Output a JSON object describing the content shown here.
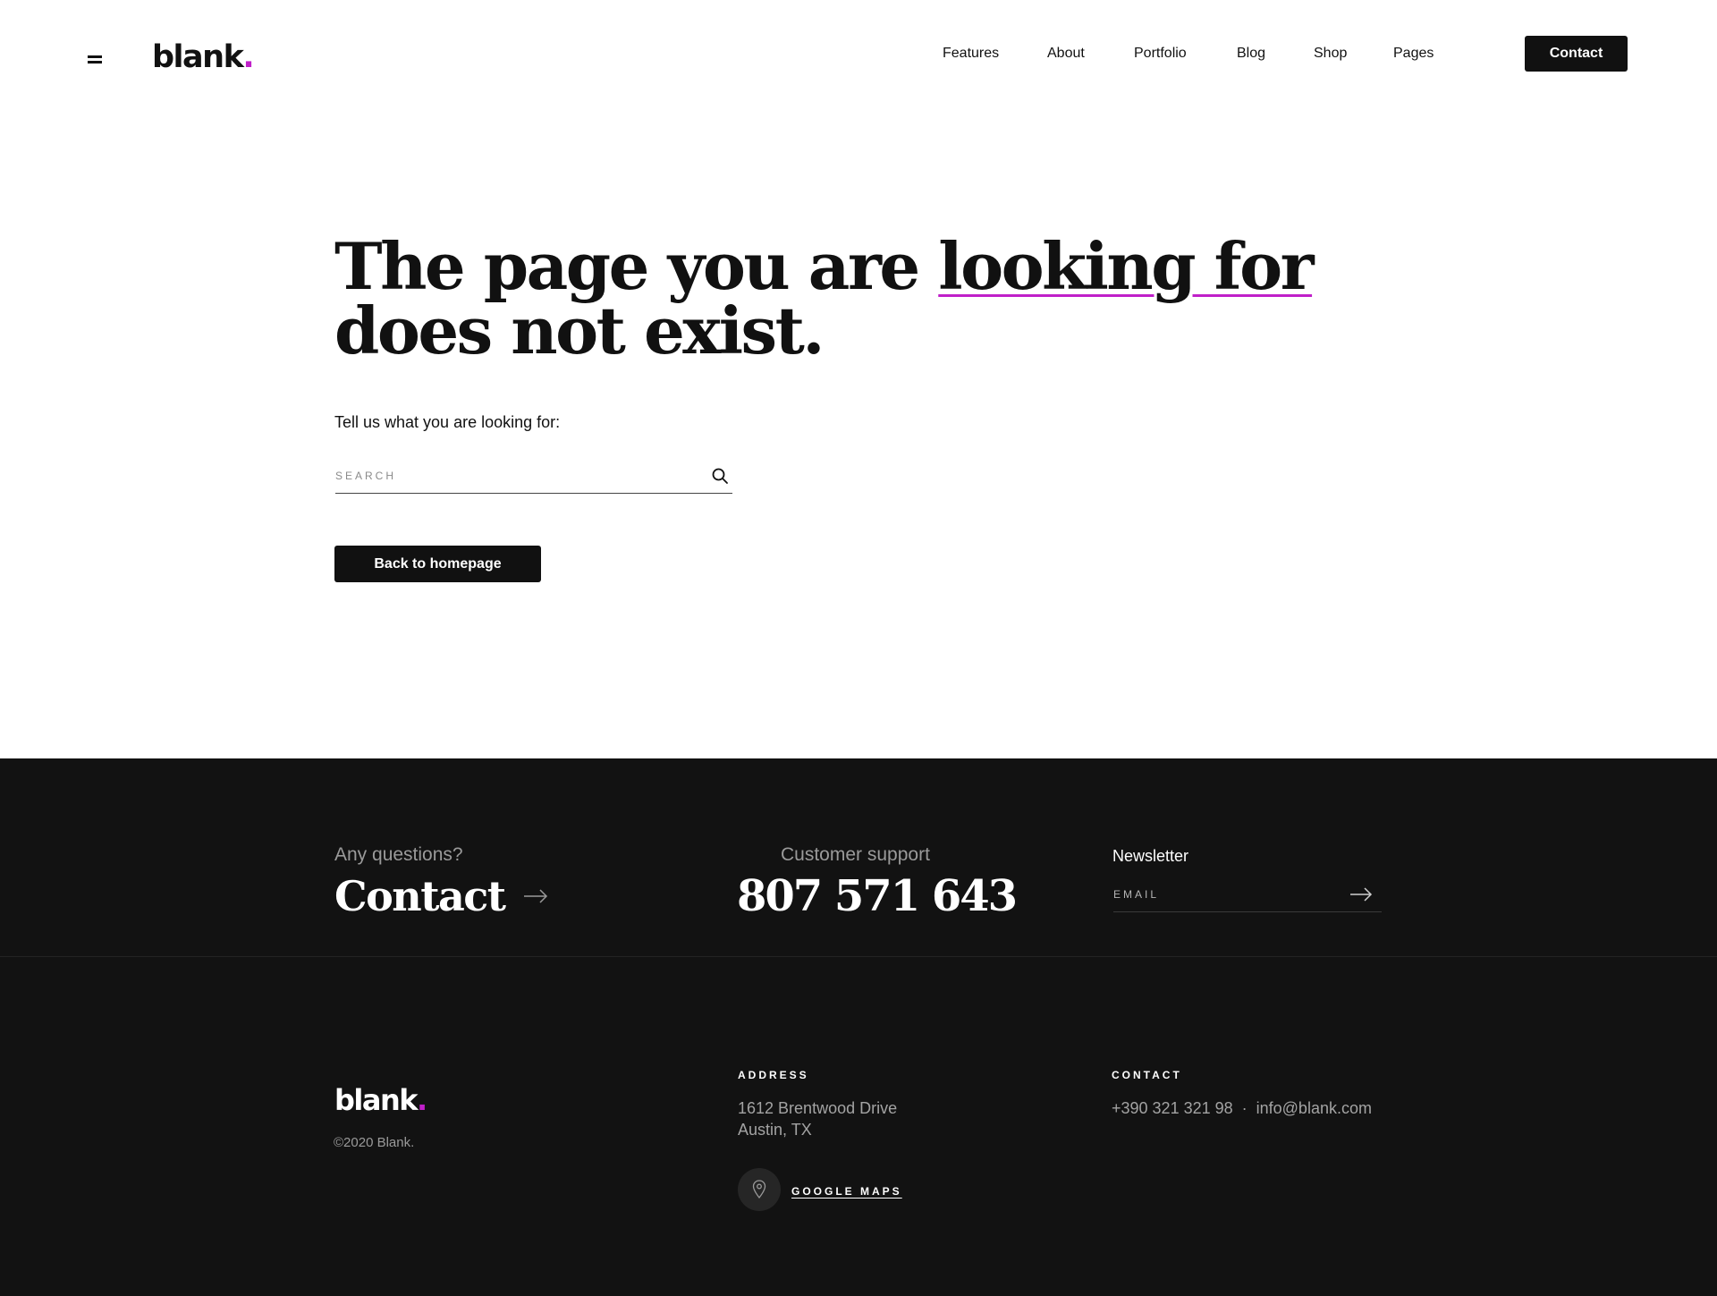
{
  "header": {
    "logo_text": "blank",
    "logo_dot": ".",
    "nav": [
      {
        "label": "Features"
      },
      {
        "label": "About"
      },
      {
        "label": "Portfolio"
      },
      {
        "label": "Blog"
      },
      {
        "label": "Shop"
      },
      {
        "label": "Pages"
      }
    ],
    "contact_button": "Contact"
  },
  "main": {
    "headline_part1": "The page you are ",
    "headline_highlight": "looking for",
    "headline_part2": "does not exist.",
    "prompt": "Tell us what you are looking for:",
    "search_placeholder": "SEARCH",
    "back_button": "Back to homepage"
  },
  "footer": {
    "questions_label": "Any questions?",
    "contact_link": "Contact",
    "support_label": "Customer support",
    "phone": "807 571 643",
    "newsletter_title": "Newsletter",
    "email_placeholder": "EMAIL",
    "logo_text": "blank",
    "logo_dot": ".",
    "copyright": "©2020 Blank.",
    "address_heading": "ADDRESS",
    "address_line1": "1612  Brentwood Drive",
    "address_line2": "Austin, TX",
    "maps_link": "GOOGLE MAPS",
    "contact_heading": "CONTACT",
    "contact_phone": "+390 321 321 98",
    "contact_sep": "·",
    "contact_email": "info@blank.com"
  },
  "colors": {
    "accent": "#c01fc9",
    "dark": "#111111",
    "footer_bg": "#121212"
  },
  "icons": [
    "menu-icon",
    "search-icon",
    "arrow-right-icon",
    "map-pin-icon"
  ]
}
